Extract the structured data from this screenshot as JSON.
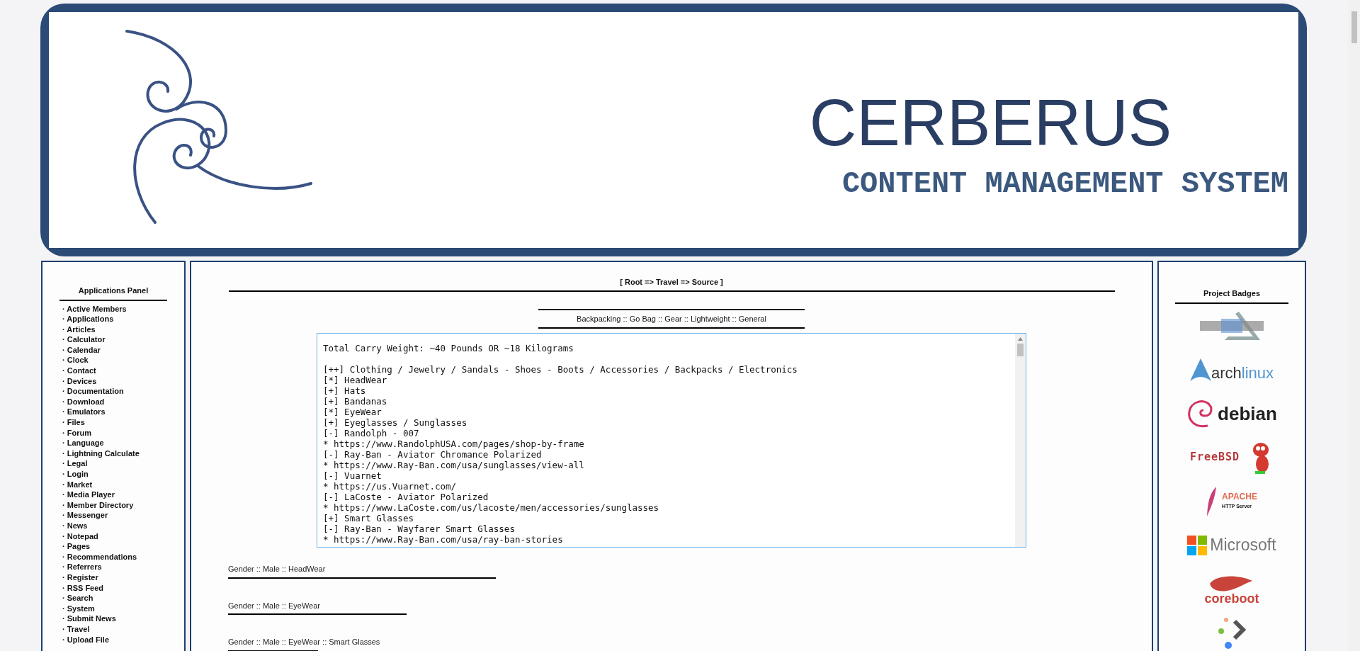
{
  "banner": {
    "title": "CERBERUS",
    "subtitle": "CONTENT MANAGEMENT SYSTEM"
  },
  "applications_panel": {
    "title": "Applications Panel",
    "items": [
      "· Active Members",
      "· Applications",
      "· Articles",
      "· Calculator",
      "· Calendar",
      "· Clock",
      "· Contact",
      "· Devices",
      "· Documentation",
      "· Download",
      "· Emulators",
      "· Files",
      "· Forum",
      "· Language",
      "· Lightning Calculate",
      "· Legal",
      "· Login",
      "· Market",
      "· Media Player",
      "· Member Directory",
      "· Messenger",
      "· News",
      "· Notepad",
      "· Pages",
      "· Recommendations",
      "· Referrers",
      "· Register",
      "· RSS Feed",
      "· Search",
      "· System",
      "· Submit News",
      "· Travel",
      "· Upload File"
    ]
  },
  "content": {
    "breadcrumb": "[ Root => Travel => Source ]",
    "tags": "Backpacking :: Go Bag :: Gear :: Lightweight :: General",
    "text_summary": "Total Carry Weight: ~40 Pounds OR ~18 Kilograms",
    "text_lines": [
      "[++] Clothing / Jewelry / Sandals - Shoes - Boots / Accessories / Backpacks / Electronics",
      "[*] HeadWear",
      "[+] Hats",
      "[+] Bandanas",
      "[*] EyeWear",
      "[+] Eyeglasses / Sunglasses",
      "[-] Randolph - 007",
      "* https://www.RandolphUSA.com/pages/shop-by-frame",
      "[-] Ray-Ban - Aviator Chromance Polarized",
      "* https://www.Ray-Ban.com/usa/sunglasses/view-all",
      "[-] Vuarnet",
      "* https://us.Vuarnet.com/",
      "[-] LaCoste - Aviator Polarized",
      "* https://www.LaCoste.com/us/lacoste/men/accessories/sunglasses",
      "[+] Smart Glasses",
      "[-] Ray-Ban - Wayfarer Smart Glasses",
      "* https://www.Ray-Ban.com/usa/ray-ban-stories"
    ],
    "sections": [
      "Gender :: Male :: HeadWear",
      "Gender :: Male :: EyeWear",
      "Gender :: Male :: EyeWear :: Smart Glasses"
    ]
  },
  "project_badges": {
    "title": "Project Badges",
    "badges": [
      {
        "kind": "cerberus"
      },
      {
        "kind": "arch",
        "label": "arch",
        "label_2": "linux"
      },
      {
        "kind": "debian",
        "label": "debian"
      },
      {
        "kind": "freebsd",
        "label": "FreeBSD"
      },
      {
        "kind": "apache",
        "label": "APACHE",
        "label_2": "HTTP Server"
      },
      {
        "kind": "microsoft",
        "label": "Microsoft"
      },
      {
        "kind": "coreboot",
        "label": "coreboot"
      },
      {
        "kind": "arrow"
      }
    ]
  }
}
